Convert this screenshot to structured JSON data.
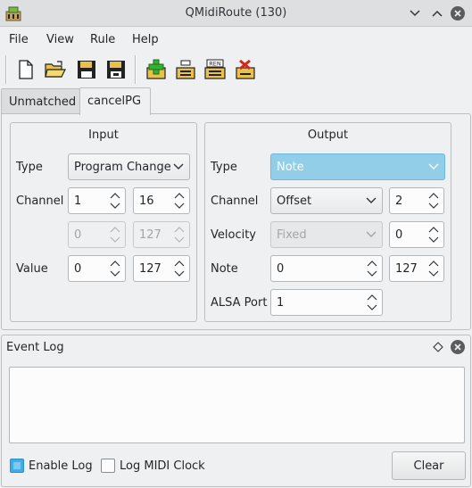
{
  "window": {
    "title": "QMidiRoute (130)"
  },
  "icons": {
    "app": "qmidiroute-app-icon",
    "minimize": "chevron-down-icon",
    "maximize": "chevron-up-icon",
    "close": "close-icon"
  },
  "menu": [
    "File",
    "View",
    "Rule",
    "Help"
  ],
  "toolbar": {
    "buttons": [
      "new-document-icon",
      "open-folder-icon",
      "save-icon",
      "save-as-icon",
      "add-rule-icon",
      "rule-down-icon",
      "rename-rule-icon",
      "delete-rule-icon"
    ],
    "rename_badge": "REN"
  },
  "tabs": [
    "Unmatched",
    "cancelPG"
  ],
  "input": {
    "title": "Input",
    "type_label": "Type",
    "type_value": "Program Change",
    "channel_label": "Channel",
    "channel_min": "1",
    "channel_max": "16",
    "disabled_min": "0",
    "disabled_max": "127",
    "value_label": "Value",
    "value_min": "0",
    "value_max": "127"
  },
  "output": {
    "title": "Output",
    "type_label": "Type",
    "type_value": "Note",
    "channel_label": "Channel",
    "channel_mode": "Offset",
    "channel_value": "2",
    "velocity_label": "Velocity",
    "velocity_mode": "Fixed",
    "velocity_value": "0",
    "note_label": "Note",
    "note_min": "0",
    "note_max": "127",
    "alsa_label": "ALSA Port",
    "alsa_value": "1"
  },
  "event_log": {
    "title": "Event Log",
    "enable_log_label": "Enable Log",
    "enable_log_checked": true,
    "log_clock_label": "Log MIDI Clock",
    "log_clock_checked": false,
    "clear_label": "Clear"
  },
  "colors": {
    "accent": "#3daee9",
    "highlight_combo": "#93cee9",
    "window_bg": "#eff0f1"
  }
}
